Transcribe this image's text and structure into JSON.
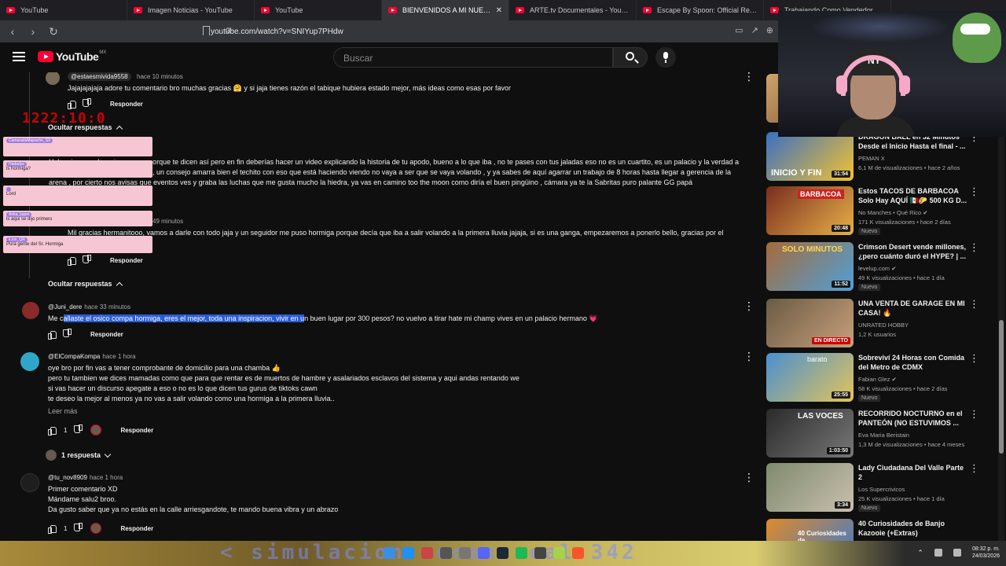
{
  "browser": {
    "tabs": [
      {
        "label": "YouTube",
        "active": false
      },
      {
        "label": "Imagen Noticias - YouTube",
        "active": false
      },
      {
        "label": "YouTube",
        "active": false
      },
      {
        "label": "BIENVENIDOS A MI NUEVO HO",
        "active": true
      },
      {
        "label": "ARTE.tv Documentales - YouTube",
        "active": false
      },
      {
        "label": "Escape By Spoon: Official Reveal Trai",
        "active": false
      },
      {
        "label": "Trabajando Como Vendedor Hasta C",
        "active": false
      }
    ],
    "url": "youtube.com/watch?v=SNIYup7PHdw"
  },
  "youtube": {
    "brand": "YouTube",
    "country": "MX",
    "search_placeholder": "Buscar"
  },
  "overlay": {
    "timer": "1222:10:0",
    "chat": [
      {
        "user": "CamaradaMapache_SX",
        "msg": ""
      },
      {
        "user": "Hadadye",
        "msg": "ls hormiga?"
      },
      {
        "user": "",
        "msg": "Lord"
      },
      {
        "user": "Anka_lagon",
        "msg": "ls aqui se dijo primero"
      },
      {
        "user": "iLion_QR",
        "msg": "Pura gente del Sr. Hormiga"
      }
    ]
  },
  "comments": {
    "c1": {
      "handle": "@estaesmivida9558",
      "time": "hace 10 minutos",
      "text": "Jajajajajaja adore tu comentario bro muchas gracias 🤗 y si jaja tienes razón el tabique hubiera estado mejor, más ideas como esas por favor",
      "reply": "Responder"
    },
    "hide1": "Ocultar respuestas",
    "c2": {
      "line1": "Hola mi compa hormiga , no se porque te dicen así pero en fin deberías hacer un video explicando la historia de tu apodo, bueno a lo que iba , no te pases con tus jaladas eso no es un cuartito, es un palacio y la verdad a",
      "line2": ", un consejo amarra bien el techito con eso que está haciendo viendo no vaya a ser que se vaya volando , y ya sabes de aquí agarrar un trabajo de 8 horas hasta llegar a gerencia de la",
      "line3": "arena , por cierto nos avisas que eventos ves y graba las luchas que me gusta mucho la hiedra, ya vas en camino too the moon como diría el buen pingüino , cámara ya te la Sabritas puro palante GG papá"
    },
    "c3": {
      "time": "49 minutos",
      "text": "Mil gracias hermanitooo, vamos a darle con todo jaja y un seguidor me puso hormiga porque decía que iba a salir volando a la primera lluvia jajaja, si es una ganga, empezaremos a ponerlo bello, gracias por el",
      "reply": "Responder"
    },
    "hide2": "Ocultar respuestas",
    "c4": {
      "handle": "@Juni_dere",
      "time": "hace 33 minutos",
      "text_pre": "Me c",
      "text_hl": "allaste el osico compa hormiga, eres el mejor, toda una inspiracion, vivir en u",
      "text_post": "n buen lugar por 300 pesos? no vuelvo a tirar hate mi champ vives en un palacio hermano 💗",
      "reply": "Responder"
    },
    "c5": {
      "handle": "@ElCompaKompa",
      "time": "hace 1 hora",
      "lines": [
        "oye bro por fin vas a tener comprobante de domicilio para una chamba 👍",
        "pero tu tambien we dices mamadas como que para que rentar es de muertos de hambre y asalariados esclavos del sistema y aqui andas rentando we",
        "si vas hacer un discurso apegate a eso o no es lo que dicen tus gurus de tiktoks cawn",
        "te deseo la mejor al menos ya no vas a salir volando como una hormiga a la primera lluvia.."
      ],
      "readmore": "Leer más",
      "likes": "1",
      "reply": "Responder",
      "replies_toggle": "1 respuesta"
    },
    "c6": {
      "handle": "@tu_nov8909",
      "time": "hace 1 hora",
      "lines": [
        "Primer comentario XD",
        "Mándame salu2 broo.",
        "Da gusto saber que ya no estás en la calle arriesgandote, te mando buena vibra y un abrazo"
      ],
      "likes": "1",
      "reply": "Responder"
    }
  },
  "sidebar": {
    "items": [
      {
        "title": "DRAGON BALL en 32 Minutos Desde el Inicio Hasta el final - ...",
        "channel": "PEMAN X",
        "meta": "6,1 M de visualizaciones • hace 2 años",
        "duration": "31:54",
        "badge": "",
        "thumb_caption": "INICIO Y FIN",
        "color1": "#3a6fc2",
        "color2": "#f2c230"
      },
      {
        "title": "Estos TACOS DE BARBACOA Solo Hay AQUÍ 🇲🇽🌮 500 KG D...",
        "channel": "No Manches • Qué Rico ✔",
        "meta": "171 K visualizaciones • hace 2 días",
        "duration": "20:48",
        "badge": "Nuevo",
        "thumb_caption": "BARBACOA",
        "color1": "#7a2d1e",
        "color2": "#e7b04a"
      },
      {
        "title": "Crimson Desert vende millones, ¿pero cuánto duró el HYPE? | ...",
        "channel": "levelup.com ✔",
        "meta": "49 K visualizaciones • hace 1 día",
        "duration": "11:52",
        "badge": "Nuevo",
        "thumb_caption": "SOLO MINUTOS",
        "color1": "#a66a3a",
        "color2": "#4fa0d8"
      },
      {
        "title": "UNA VENTA DE GARAGE EN MI CASA! 🔥",
        "channel": "UNRATED HOBBY",
        "meta": "1,2 K usuarios",
        "duration": "EN DIRECTO",
        "badge": "",
        "thumb_caption": "",
        "color1": "#6b5b45",
        "color2": "#c7a07a"
      },
      {
        "title": "Sobreviví 24 Horas con Comida del Metro de CDMX",
        "channel": "Fabian Glez ✔",
        "meta": "58 K visualizaciones • hace 2 días",
        "duration": "25:55",
        "badge": "Nuevo",
        "thumb_caption": "barato",
        "color1": "#4a8fd0",
        "color2": "#e2c45b"
      },
      {
        "title": "RECORRIDO NOCTURNO en el PANTEÓN (NO ESTUVIMOS ...",
        "channel": "Eva Maria Beristain",
        "meta": "1,3 M de visualizaciones • hace 4 meses",
        "duration": "1:03:50",
        "badge": "",
        "thumb_caption": "LAS VOCES",
        "color1": "#2a2a2a",
        "color2": "#d9d9d9"
      },
      {
        "title": "Lady Ciudadana Del Valle Parte 2",
        "channel": "Los Supercrivicos",
        "meta": "25 K visualizaciones • hace 1 día",
        "duration": "3:34",
        "badge": "Nuevo",
        "thumb_caption": "",
        "color1": "#7e8a6d",
        "color2": "#c9bfae"
      },
      {
        "title": "40 Curiosidades de Banjo Kazooie (+Extras)",
        "channel": "",
        "meta": "",
        "duration": "",
        "badge": "",
        "thumb_caption": "40 Curiosidades de",
        "color1": "#e08a2a",
        "color2": "#3a7ad0"
      }
    ]
  },
  "webcam": {
    "cap_logo": "NY"
  },
  "taskbar": {
    "overlay_text": "< simulacion mecan real 342",
    "time": "08:32 p. m.",
    "date": "24/03/2026"
  }
}
